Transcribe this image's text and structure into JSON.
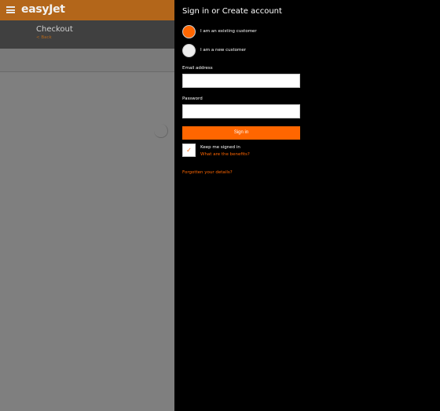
{
  "background_page": {
    "brand": "easyJet",
    "checkout_title": "Checkout",
    "back_link": "< Back"
  },
  "signin_panel": {
    "title": "Sign in or Create account",
    "options": [
      {
        "label": "I am an existing customer",
        "selected": true
      },
      {
        "label": "I am a new customer",
        "selected": false
      }
    ],
    "email_label": "Email address",
    "email_value": "",
    "password_label": "Password",
    "password_value": "",
    "signin_button": "Sign in",
    "keep_signed_in_label": "Keep me signed in",
    "keep_signed_in_checked": true,
    "checkbox_mark": "✓",
    "benefits_link": "What are the benefits?",
    "forgot_link": "Forgotten your details?"
  },
  "colors": {
    "accent": "#ff6600",
    "panel_bg": "#000000",
    "dimmed_page": "#7f7f7f"
  }
}
